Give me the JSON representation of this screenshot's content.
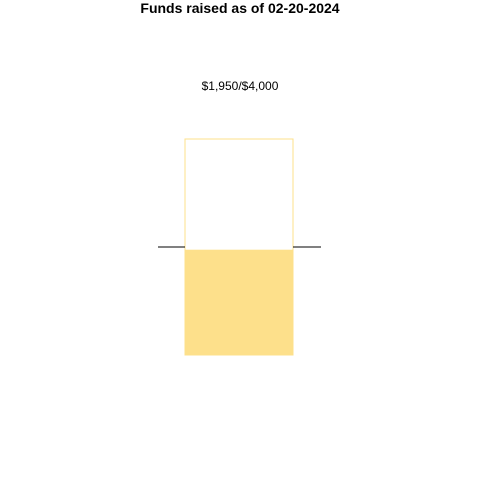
{
  "chart_data": {
    "type": "bar",
    "title": "Funds raised as of 02-20-2024",
    "amount_label": "$1,950/$4,000",
    "raised": 1950,
    "goal": 4000,
    "ylim": [
      0,
      4000
    ],
    "marker_value": 2000,
    "fill_color": "#FDE08B",
    "outline_color": "#FDE08B",
    "marker_color": "#000000",
    "grid": false
  }
}
